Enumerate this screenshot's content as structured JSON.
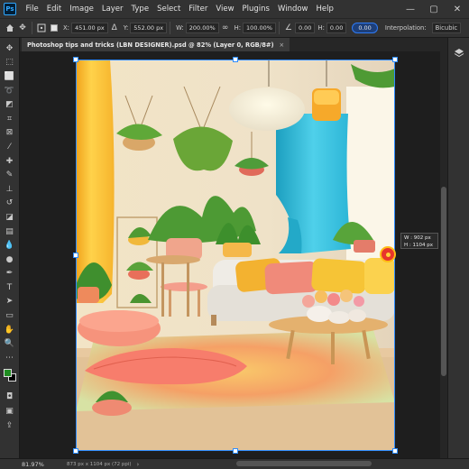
{
  "menubar": {
    "app_logo": "Ps",
    "items": [
      "File",
      "Edit",
      "Image",
      "Layer",
      "Type",
      "Select",
      "Filter",
      "View",
      "Plugins",
      "Window",
      "Help"
    ],
    "window_controls": [
      "—",
      "▢",
      "✕"
    ]
  },
  "options": {
    "x_label": "X:",
    "x_value": "451.00 px",
    "y_label": "Y:",
    "y_value": "552.00 px",
    "w_label": "W:",
    "w_value": "200.00%",
    "h_label": "H:",
    "h_value": "100.00%",
    "angle_value": "0.00",
    "hskew_label": "H:",
    "hskew_value": "0.00",
    "vskew_value": "0.00",
    "interpolation_label": "Interpolation:",
    "interpolation_value": "Bicubic"
  },
  "tab": {
    "title": "Photoshop tips and tricks (LBN DESIGNER).psd @ 82% (Layer 0, RGB/8#)",
    "close": "×"
  },
  "tooltip": {
    "w_line": "W :   902 px",
    "h_line": "H :  1104 px"
  },
  "status": {
    "zoom": "81.97%",
    "doc_info": "873 px x 1104 px (72 ppi)",
    "arrow": "›"
  },
  "colors": {
    "foreground": "#1f8c21",
    "background": "#000000",
    "selection": "#2e8cff"
  },
  "tools": [
    "move-icon",
    "artboard-icon",
    "marquee-icon",
    "lasso-icon",
    "object-select-icon",
    "crop-icon",
    "frame-icon",
    "eyedropper-icon",
    "healing-icon",
    "brush-icon",
    "stamp-icon",
    "history-brush-icon",
    "eraser-icon",
    "gradient-icon",
    "blur-icon",
    "dodge-icon",
    "pen-icon",
    "type-icon",
    "path-select-icon",
    "rectangle-icon",
    "hand-icon",
    "zoom-icon",
    "more-icon"
  ]
}
